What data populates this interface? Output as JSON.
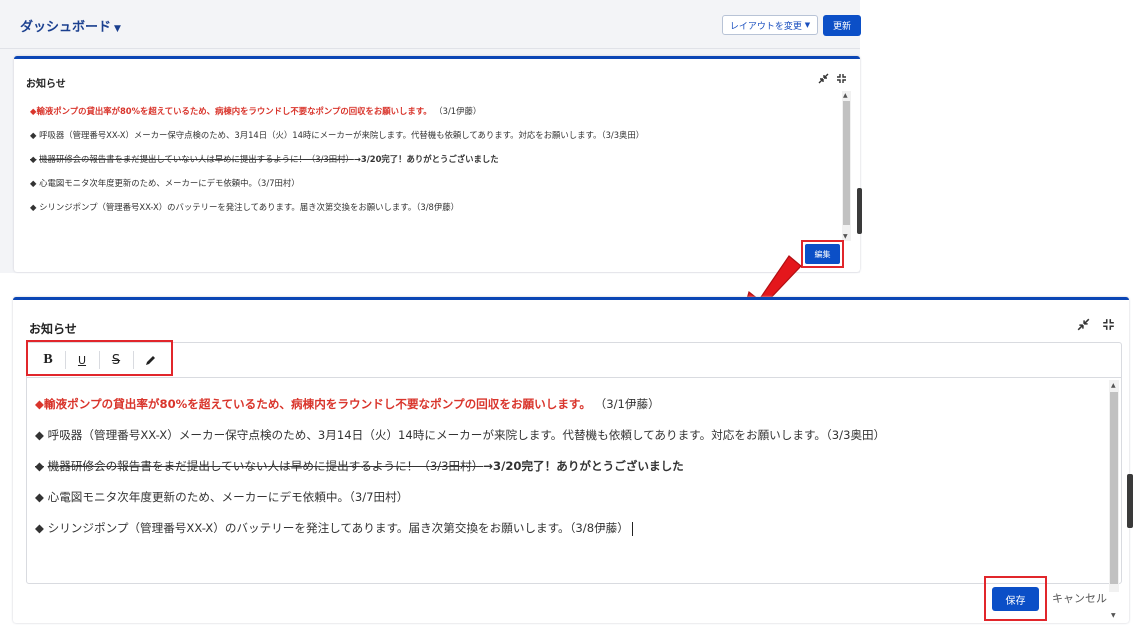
{
  "header": {
    "dashboard_label": "ダッシュボード",
    "layout_button": "レイアウトを変更",
    "refresh_button": "更新"
  },
  "notice_card": {
    "title": "お知らせ",
    "edit_button": "編集",
    "items": [
      {
        "bullet": "◆",
        "main": "輸液ポンプの貸出率が80%を超えているため、病棟内をラウンドし不要なポンプの回収をお願いします。",
        "suffix": "（3/1伊藤）"
      },
      {
        "bullet": "◆",
        "main": "呼吸器（管理番号XX-X）メーカー保守点検のため、3月14日（火）14時にメーカーが来院します。代替機も依頼してあります。対応をお願いします。（3/3奥田）"
      },
      {
        "bullet": "◆",
        "strike": "機器研修会の報告書をまだ提出していない人は早めに提出するように！（3/3田村）",
        "done": "→3/20完了！ありがとうございました"
      },
      {
        "bullet": "◆",
        "main": "心電図モニタ次年度更新のため、メーカーにデモ依頼中。（3/7田村）"
      },
      {
        "bullet": "◆",
        "main": "シリンジポンプ（管理番号XX-X）のバッテリーを発注してあります。届き次第交換をお願いします。（3/8伊藤）"
      }
    ]
  },
  "editor_card": {
    "title": "お知らせ",
    "toolbar": {
      "bold": "B",
      "underline": "U",
      "strike": "S"
    },
    "save_button": "保存",
    "cancel_button": "キャンセル"
  },
  "colors": {
    "accent": "#0b4fc7",
    "highlight_red": "#e1262b",
    "notice_red": "#d9352c"
  },
  "icons": [
    "caret-down-icon",
    "shrink-icon",
    "collapse-icon",
    "pen-icon",
    "arrow-icon"
  ]
}
